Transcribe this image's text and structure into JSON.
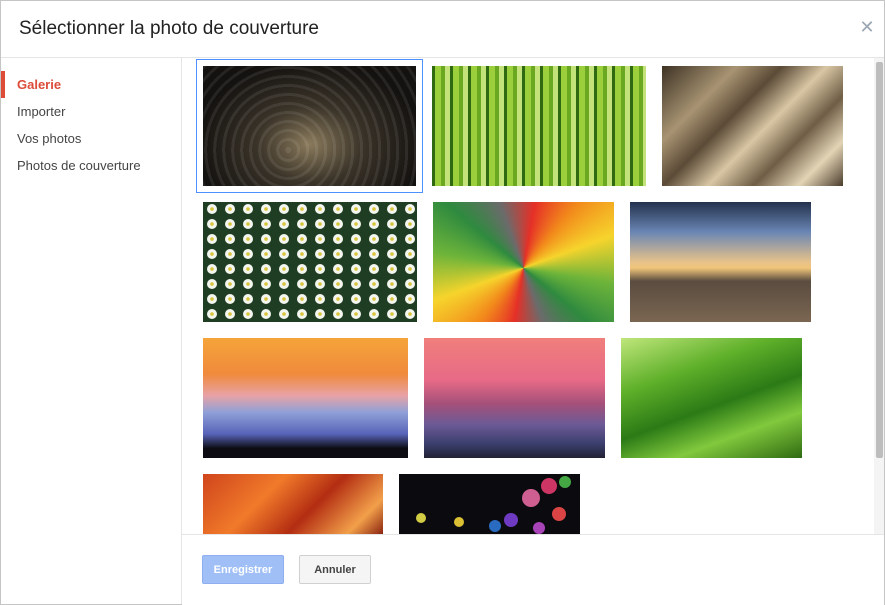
{
  "dialog": {
    "title": "Sélectionner la photo de couverture",
    "close_icon": "close-icon"
  },
  "sidebar": {
    "items": [
      {
        "label": "Galerie",
        "active": true
      },
      {
        "label": "Importer",
        "active": false
      },
      {
        "label": "Vos photos",
        "active": false
      },
      {
        "label": "Photos de couverture",
        "active": false
      }
    ]
  },
  "gallery": {
    "selected_index": 0,
    "photos": [
      "water-drops-photo",
      "horsetail-plants-photo",
      "paper-folds-photo",
      "white-daisies-photo",
      "colorful-petals-photo",
      "beach-sunset-photo",
      "sunrise-over-clouds-photo",
      "purple-mountains-photo",
      "green-grass-photo",
      "autumn-leaves-photo",
      "bokeh-lights-photo"
    ]
  },
  "footer": {
    "save_label": "Enregistrer",
    "cancel_label": "Annuler"
  },
  "colors": {
    "accent_red": "#dd4b39",
    "save_button": "#a0bff6",
    "selection_outline": "#4d90fe"
  }
}
